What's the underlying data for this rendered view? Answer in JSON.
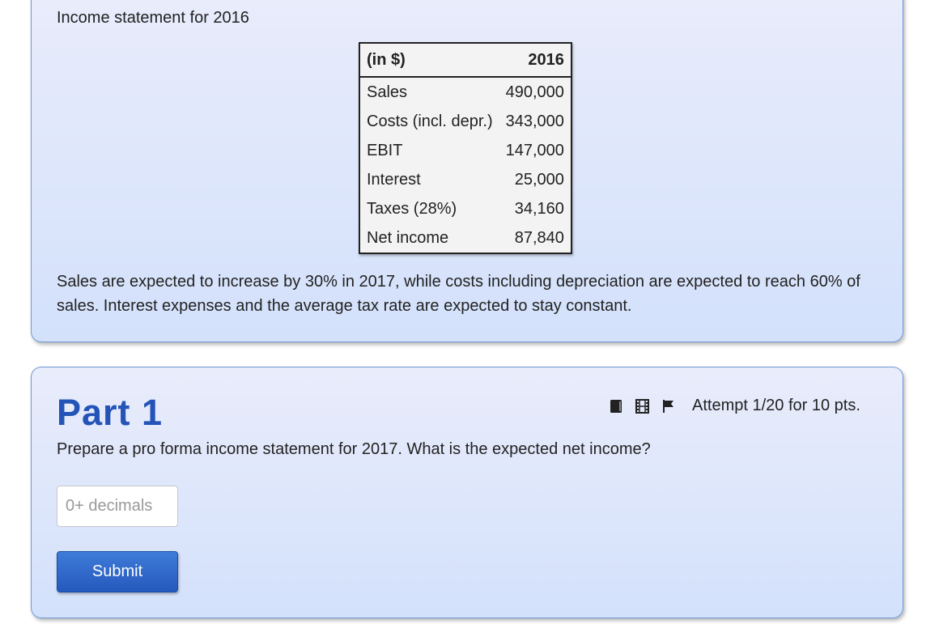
{
  "problem": {
    "heading": "Income statement for 2016",
    "table": {
      "headers": [
        "(in $)",
        "2016"
      ],
      "rows": [
        {
          "label": "Sales",
          "value": "490,000"
        },
        {
          "label": "Costs (incl. depr.)",
          "value": "343,000"
        },
        {
          "label": "EBIT",
          "value": "147,000"
        },
        {
          "label": "Interest",
          "value": "25,000"
        },
        {
          "label": "Taxes (28%)",
          "value": "34,160"
        },
        {
          "label": "Net income",
          "value": "87,840"
        }
      ]
    },
    "description": "Sales are expected to increase by 30% in 2017, while costs including depreciation are expected to reach 60% of sales. Interest expenses and the average tax rate are expected to stay constant."
  },
  "part": {
    "title": "Part 1",
    "tools": [
      "book-icon",
      "film-icon",
      "flag-icon"
    ],
    "attempt": "Attempt 1/20 for 10 pts.",
    "question": "Prepare a pro forma income statement for 2017. What is the expected net income?",
    "answer_value": "",
    "answer_placeholder": "0+ decimals",
    "submit_label": "Submit",
    "accent_color": "#2454b8",
    "button_color": "#2f67cc"
  }
}
